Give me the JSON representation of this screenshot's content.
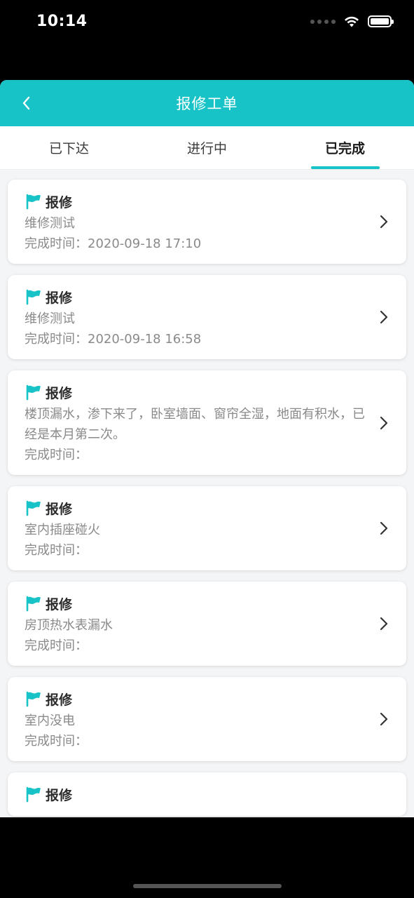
{
  "status_bar": {
    "time": "10:14"
  },
  "nav": {
    "title": "报修工单",
    "back_icon": "chevron-left-icon"
  },
  "tabs": [
    {
      "label": "已下达",
      "active": false
    },
    {
      "label": "进行中",
      "active": false
    },
    {
      "label": "已完成",
      "active": true
    }
  ],
  "colors": {
    "accent": "#18c3c8",
    "flag": "#18c3c8",
    "muted_text": "#8a8a8a"
  },
  "orders": [
    {
      "type": "报修",
      "desc": "维修测试",
      "time": "完成时间：2020-09-18 17:10"
    },
    {
      "type": "报修",
      "desc": "维修测试",
      "time": "完成时间：2020-09-18 16:58"
    },
    {
      "type": "报修",
      "desc": "楼顶漏水，渗下来了，卧室墙面、窗帘全湿，地面有积水，已经是本月第二次。",
      "time": "完成时间："
    },
    {
      "type": "报修",
      "desc": "室内插座碰火",
      "time": "完成时间："
    },
    {
      "type": "报修",
      "desc": "房顶热水表漏水",
      "time": "完成时间："
    },
    {
      "type": "报修",
      "desc": "室内没电",
      "time": "完成时间："
    },
    {
      "type": "报修",
      "desc": "",
      "time": ""
    }
  ]
}
